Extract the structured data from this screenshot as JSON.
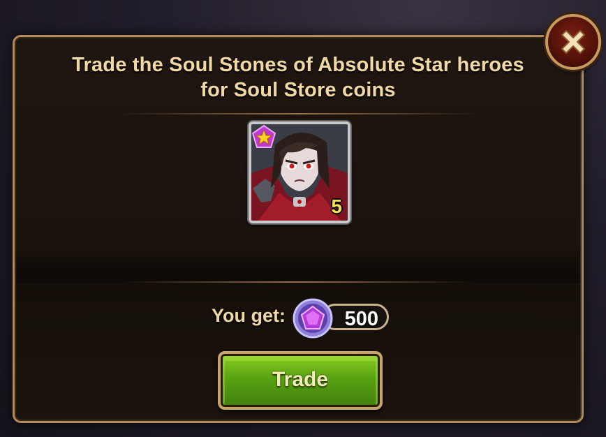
{
  "dialog": {
    "title": "Trade the Soul Stones of Absolute Star heroes for Soul Store coins",
    "close_icon": "close-x-icon"
  },
  "hero": {
    "portrait_icon": "vampire-hero-portrait",
    "star_badge_icon": "star-pentagon-icon",
    "level": "5"
  },
  "reward": {
    "label": "You get:",
    "currency_icon": "soul-store-coin-icon",
    "amount": "500"
  },
  "trade_button": {
    "label": "Trade"
  },
  "colors": {
    "title_text": "#f1d9a6",
    "trade_button_green": "#5aa313",
    "close_button_red": "#7a1f12",
    "frame_gold": "#b08a5a"
  }
}
